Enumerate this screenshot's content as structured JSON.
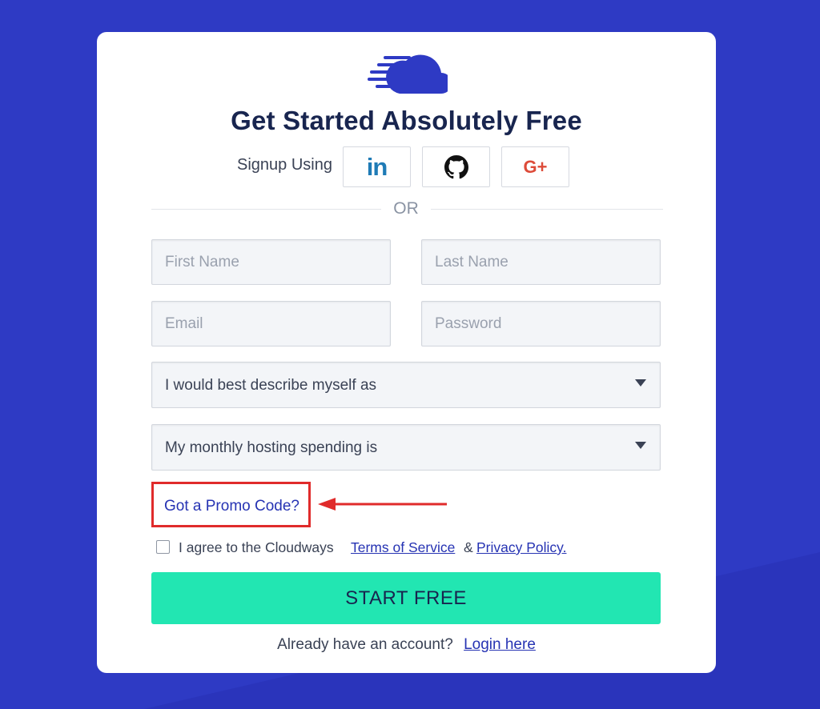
{
  "colors": {
    "background": "#2e3ac4",
    "card": "#ffffff",
    "accent_button": "#22e6b2",
    "link": "#2633b3",
    "highlight": "#e02b2b",
    "title": "#18254f"
  },
  "logo": {
    "icon": "cloudways-cloud-logo-icon"
  },
  "title": "Get Started Absolutely Free",
  "signup": {
    "label": "Signup Using",
    "providers": [
      {
        "name": "linkedin",
        "icon": "linkedin-icon",
        "text": "in"
      },
      {
        "name": "github",
        "icon": "github-icon"
      },
      {
        "name": "google-plus",
        "icon": "google-plus-icon",
        "text": "G+"
      }
    ]
  },
  "divider": {
    "text": "OR"
  },
  "form": {
    "first_name": {
      "placeholder": "First Name",
      "value": ""
    },
    "last_name": {
      "placeholder": "Last Name",
      "value": ""
    },
    "email": {
      "placeholder": "Email",
      "value": ""
    },
    "password": {
      "placeholder": "Password",
      "value": ""
    },
    "describe": {
      "selected": "I would best describe myself as",
      "icon": "caret-down-icon"
    },
    "spending": {
      "selected": "My monthly hosting spending is",
      "icon": "caret-down-icon"
    }
  },
  "promo": {
    "label": "Got a Promo Code?",
    "annotation_icon": "red-arrow-icon"
  },
  "agreement": {
    "checked": false,
    "text": "I agree to the Cloudways",
    "tos_label": "Terms of Service",
    "ampersand": "&",
    "privacy_label": "Privacy Policy."
  },
  "submit": {
    "label": "START FREE"
  },
  "login": {
    "text": "Already have an account?",
    "link_label": "Login here"
  }
}
